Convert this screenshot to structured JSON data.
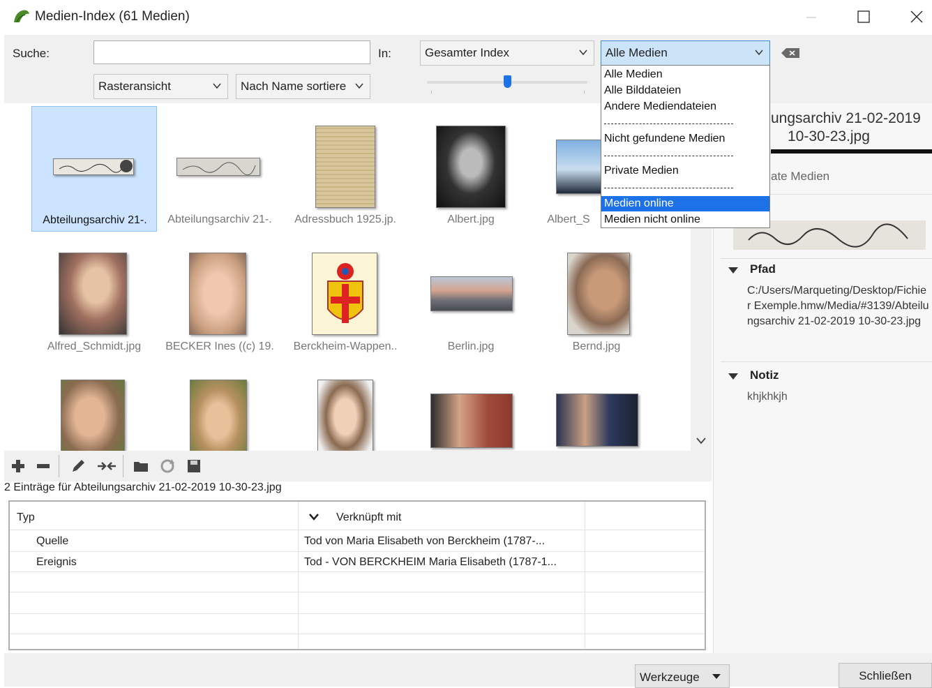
{
  "window": {
    "title": "Medien-Index (61 Medien)"
  },
  "toolbar": {
    "search_label": "Suche:",
    "search_value": "",
    "in_label": "In:",
    "scope_value": "Gesamter Index",
    "filter_value": "Alle Medien",
    "view_value": "Rasteransicht",
    "sort_value": "Nach Name sortiere",
    "zoom_level": 0.5
  },
  "filter_options": [
    {
      "label": "Alle Medien",
      "selected": false
    },
    {
      "label": "Alle Bilddateien",
      "selected": false
    },
    {
      "label": "Andere Mediendateien",
      "selected": false
    },
    {
      "label": "Nicht gefundene Medien",
      "selected": false
    },
    {
      "label": "Private Medien",
      "selected": false
    },
    {
      "label": "Medien online",
      "selected": true
    },
    {
      "label": "Medien nicht online",
      "selected": false
    }
  ],
  "grid": {
    "items": [
      {
        "caption": "Abteilungsarchiv 21-.",
        "selected": true
      },
      {
        "caption": "Abteilungsarchiv 21-."
      },
      {
        "caption": "Adressbuch 1925.jp."
      },
      {
        "caption": "Albert.jpg"
      },
      {
        "caption": "Albert_S"
      },
      {
        "caption": "Alfred_Schmidt.jpg"
      },
      {
        "caption": "BECKER Ines ((c) 19."
      },
      {
        "caption": "Berckheim-Wappen.."
      },
      {
        "caption": "Berlin.jpg"
      },
      {
        "caption": "Bernd.jpg"
      },
      {
        "caption": ""
      },
      {
        "caption": ""
      },
      {
        "caption": ""
      },
      {
        "caption": ""
      },
      {
        "caption": ""
      }
    ]
  },
  "details": {
    "title_line1": "ungsarchiv 21-02-2019",
    "title_line2": "10-30-23.jpg",
    "privacy": "ate Medien",
    "path_label": "Pfad",
    "path_value": "C:/Users/Marqueting/Desktop/Fichier Exemple.hmw/Media/#3139/Abteilungsarchiv 21-02-2019 10-30-23.jpg",
    "note_label": "Notiz",
    "note_value": "khjkhkjh"
  },
  "links": {
    "summary": "2 Einträge für Abteilungsarchiv 21-02-2019 10-30-23.jpg",
    "col_type": "Typ",
    "col_linked": "Verknüpft mit",
    "rows": [
      {
        "type": "Quelle",
        "linked": "Tod von Maria Elisabeth von Berckheim (1787-..."
      },
      {
        "type": "Ereignis",
        "linked": "Tod - VON BERCKHEIM Maria Elisabeth (1787-1..."
      }
    ]
  },
  "footer": {
    "tools_label": "Werkzeuge",
    "close_label": "Schließen"
  },
  "colors": {
    "selection": "#1e72e8",
    "grid_selection": "#cce4ff",
    "app_icon": "#4a8a2a"
  }
}
